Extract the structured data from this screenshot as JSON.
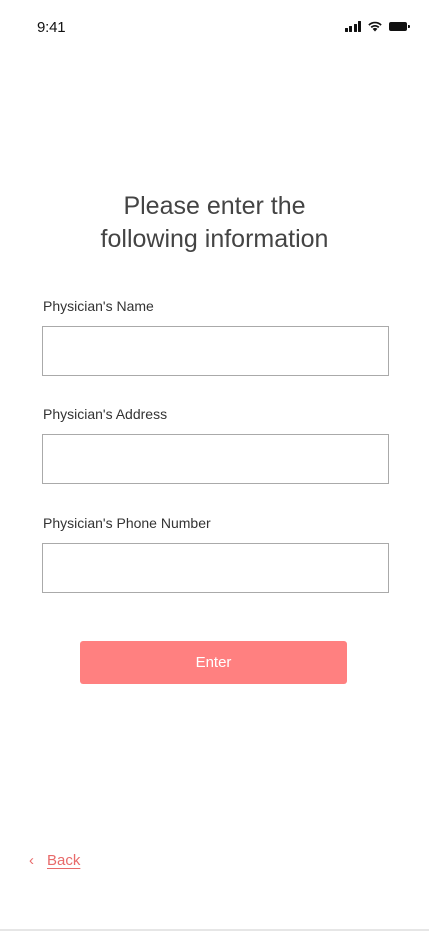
{
  "status_bar": {
    "time": "9:41",
    "icons": [
      "cellular-signal-icon",
      "wifi-icon",
      "battery-icon"
    ]
  },
  "form": {
    "title_line1": "Please enter the",
    "title_line2": "following information",
    "fields": [
      {
        "label": "Physician's Name",
        "value": "",
        "placeholder": ""
      },
      {
        "label": "Physician's Address",
        "value": "",
        "placeholder": ""
      },
      {
        "label": "Physician's Phone Number",
        "value": "",
        "placeholder": ""
      }
    ],
    "submit_label": "Enter"
  },
  "navigation": {
    "back_icon": "chevron-left-icon",
    "back_label": "Back"
  },
  "colors": {
    "accent": "#ff8080",
    "link": "#e86a6a",
    "input_border": "#aaaaaa",
    "text": "#333333"
  }
}
